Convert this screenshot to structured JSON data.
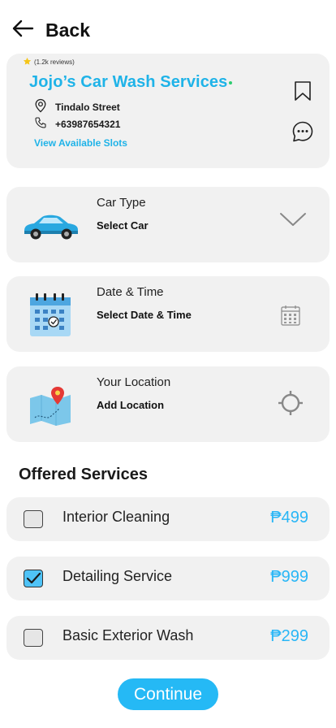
{
  "header": {
    "back_label": "Back"
  },
  "shop": {
    "reviews": "(1.2k reviews)",
    "name": "Jojo’s Car Wash Services",
    "address": "Tindalo Street",
    "phone": "+63987654321",
    "slots_link": "View Available Slots"
  },
  "pickers": [
    {
      "label": "Car Type",
      "value": "Select Car",
      "icon": "car-icon",
      "trail_icon": "chevron-down-icon"
    },
    {
      "label": "Date & Time",
      "value": "Select Date & Time",
      "icon": "calendar-icon",
      "trail_icon": "calendar-grid-icon"
    },
    {
      "label": "Your Location",
      "value": "Add Location",
      "icon": "map-icon",
      "trail_icon": "locate-icon"
    }
  ],
  "services_title": "Offered Services",
  "services": [
    {
      "name": "Interior Cleaning",
      "price": "₱499",
      "checked": false
    },
    {
      "name": "Detailing Service",
      "price": "₱999",
      "checked": true
    },
    {
      "name": "Basic Exterior Wash",
      "price": "₱299",
      "checked": false
    }
  ],
  "continue_label": "Continue",
  "colors": {
    "accent": "#1fb3e8",
    "card": "#f1f1f1",
    "button": "#25b9f5"
  }
}
